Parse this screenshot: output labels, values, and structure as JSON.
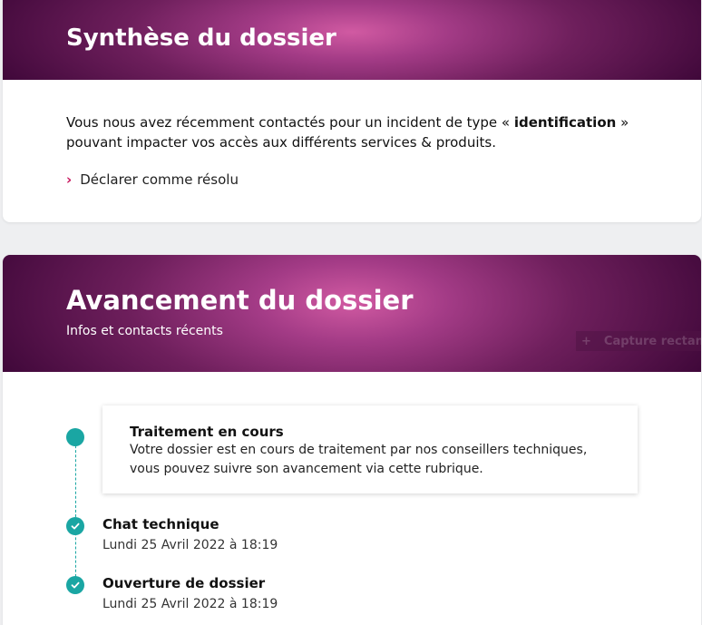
{
  "synthese": {
    "title": "Synthèse du dossier",
    "text_before": "Vous nous avez récemment contactés pour un incident de type « ",
    "incident_type": "identification",
    "text_after": " » pouvant impacter vos accès aux différents services & produits.",
    "resolve_link": "Déclarer comme résolu"
  },
  "avancement": {
    "title": "Avancement du dossier",
    "subtitle": "Infos et contacts récents",
    "watermark": "Capture rectangulaire",
    "current": {
      "title": "Traitement en cours",
      "description": "Votre dossier est en cours de traitement par nos conseillers techniques, vous pouvez suivre son avancement via cette rubrique."
    },
    "steps": [
      {
        "title": "Chat technique",
        "date": "Lundi 25 Avril 2022 à 18:19"
      },
      {
        "title": "Ouverture de dossier",
        "date": "Lundi 25 Avril 2022 à 18:19"
      }
    ]
  },
  "colors": {
    "accent_teal": "#1aa6a3",
    "chevron_pink": "#c8155d",
    "banner_dark": "#40083a",
    "banner_light": "#d15aa2"
  }
}
